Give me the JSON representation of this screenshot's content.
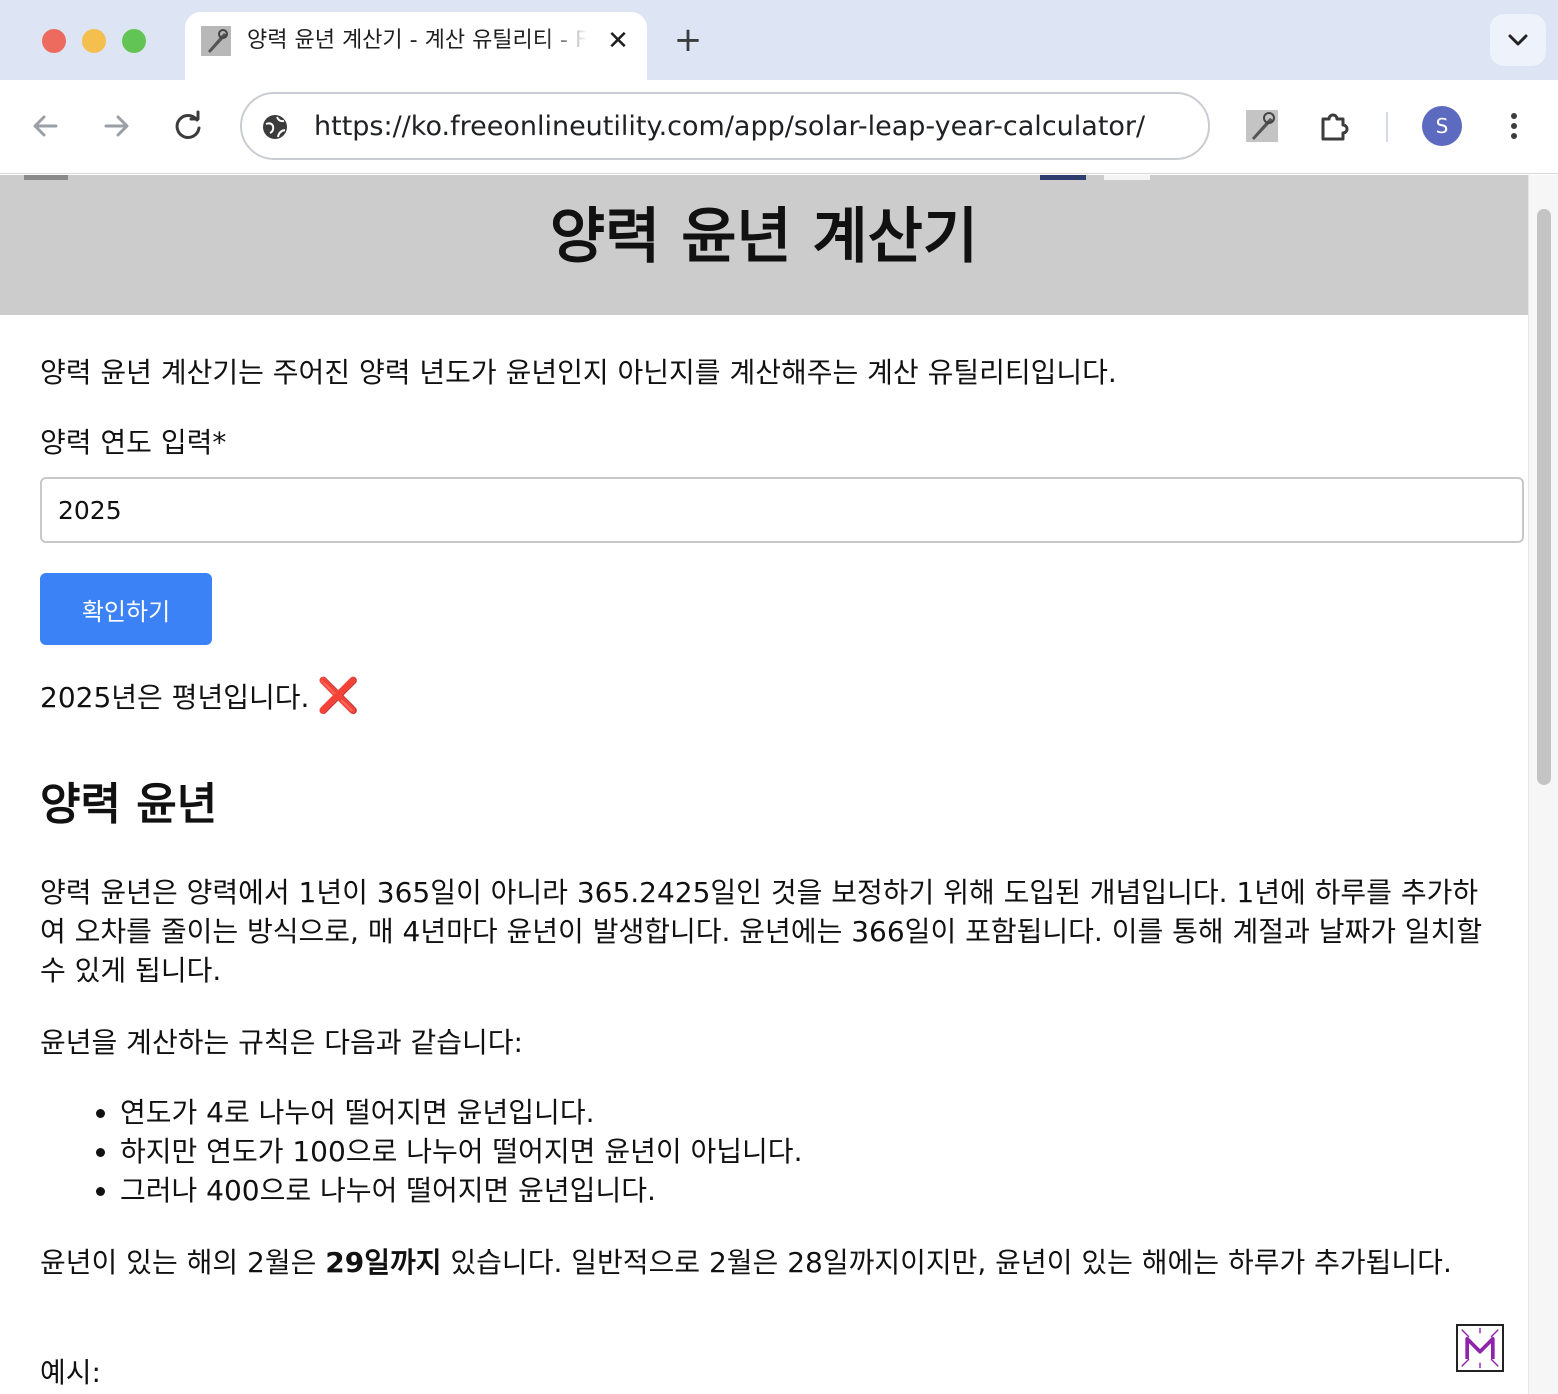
{
  "browser": {
    "tab_title": "양력 윤년 계산기 - 계산 유틸리티 - FreeOnlineUtility",
    "tab_close": "✕",
    "new_tab": "+",
    "url": "https://ko.freeonlineutility.com/app/solar-leap-year-calculator/",
    "avatar_letter": "S"
  },
  "header": {
    "title": "양력 윤년 계산기"
  },
  "main": {
    "intro": "양력 윤년 계산기는 주어진 양력 년도가 윤년인지 아닌지를 계산해주는 계산 유틸리티입니다.",
    "year_label": "양력 연도 입력*",
    "year_value": "2025",
    "check_button": "확인하기",
    "result_text": "2025년은 평년입니다.",
    "result_icon": "❌",
    "section_title": "양력 윤년",
    "paragraph1": "양력 윤년은 양력에서 1년이 365일이 아니라 365.2425일인 것을 보정하기 위해 도입된 개념입니다. 1년에 하루를 추가하여 오차를 줄이는 방식으로, 매 4년마다 윤년이 발생합니다. 윤년에는 366일이 포함됩니다. 이를 통해 계절과 날짜가 일치할 수 있게 됩니다.",
    "rules_intro": "윤년을 계산하는 규칙은 다음과 같습니다:",
    "rules": [
      "연도가 4로 나누어 떨어지면 윤년입니다.",
      "하지만 연도가 100으로 나누어 떨어지면 윤년이 아닙니다.",
      "그러나 400으로 나누어 떨어지면 윤년입니다."
    ],
    "paragraph2_before": "윤년이 있는 해의 2월은 ",
    "paragraph2_bold": "29일까지",
    "paragraph2_after": " 있습니다. 일반적으로 2월은 28일까지이지만, 윤년이 있는 해에는 하루가 추가됩니다.",
    "example_label": "예시:"
  },
  "colors": {
    "header_bg": "#cccccc",
    "button_bg": "#3b82f6",
    "result_icon": "#d9312b",
    "tabstrip_bg": "#dde4f3"
  },
  "icons": [
    "wrench-favicon-icon",
    "back-arrow-icon",
    "forward-arrow-icon",
    "reload-icon",
    "site-info-icon",
    "extension-wrench-icon",
    "puzzle-icon",
    "kebab-menu-icon",
    "chevron-down-icon",
    "m-logo-icon"
  ]
}
